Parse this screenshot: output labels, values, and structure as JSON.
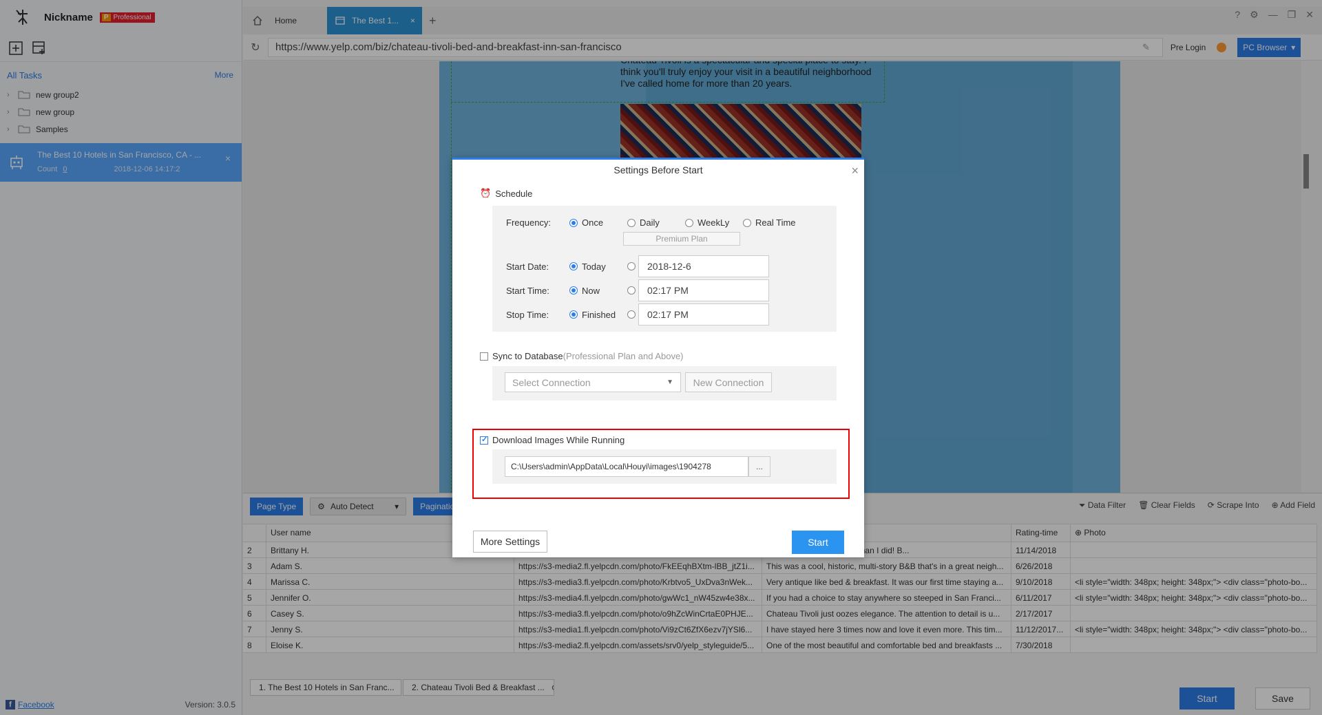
{
  "app": {
    "nickname": "Nickname",
    "plan_badge": "Professional",
    "plan_letter": "P",
    "version": "Version: 3.0.5",
    "facebook": "Facebook"
  },
  "sidebar": {
    "all_tasks": "All Tasks",
    "more": "More",
    "groups": [
      "new group2",
      "new group",
      "Samples"
    ],
    "task": {
      "name": "The Best 10 Hotels in San Francisco, CA - ...",
      "count_label": "Count",
      "count": "0",
      "date": "2018-12-06 14:17:2"
    }
  },
  "tabs": {
    "home": "Home",
    "active": "The Best 1..."
  },
  "address": {
    "url": "https://www.yelp.com/biz/chateau-tivoli-bed-and-breakfast-inn-san-francisco",
    "pre_login": "Pre Login",
    "browser": "PC Browser"
  },
  "webpage": {
    "quote": "Chateau Tivoli is a spectacular and special place to stay. I think you'll truly enjoy your visit in a beautiful neighborhood I've called home for more than 20 years."
  },
  "panel": {
    "page_type": "Page Type",
    "auto_detect": "Auto Detect",
    "pagination": "Paginatio",
    "data_filter": "Data Filter",
    "clear_fields": "Clear Fields",
    "scrape_into": "Scrape Into",
    "add_field": "Add Field",
    "columns": [
      "",
      "User name",
      "",
      "",
      "Rating-time",
      "Photo"
    ],
    "rows": [
      [
        "2",
        "Brittany H.",
        "",
        "oved this place anymore than I did! B...",
        "11/14/2018",
        ""
      ],
      [
        "3",
        "Adam S.",
        "https://s3-media2.fl.yelpcdn.com/photo/FkEEqhBXtm-lBB_jtZ1i...",
        "This was a cool, historic, multi-story B&B that's in a great neigh...",
        "6/26/2018",
        ""
      ],
      [
        "4",
        "Marissa C.",
        "https://s3-media3.fl.yelpcdn.com/photo/Krbtvo5_UxDva3nWek...",
        "Very antique like bed & breakfast. It was our first time staying a...",
        "9/10/2018",
        "<li style=\"width: 348px; height: 348px;\"> <div class=\"photo-bo..."
      ],
      [
        "5",
        "Jennifer O.",
        "https://s3-media4.fl.yelpcdn.com/photo/gwWc1_nW45zw4e38x...",
        "If you had a choice to stay anywhere so steeped in San Franci...",
        "6/11/2017",
        "<li style=\"width: 348px; height: 348px;\"> <div class=\"photo-bo..."
      ],
      [
        "6",
        "Casey S.",
        "https://s3-media3.fl.yelpcdn.com/photo/o9hZcWinCrtaE0PHJE...",
        "Chateau Tivoli just oozes elegance. The attention to detail is u...",
        "2/17/2017",
        ""
      ],
      [
        "7",
        "Jenny S.",
        "https://s3-media1.fl.yelpcdn.com/photo/Vi9zCt6ZfX6ezv7jYSl6...",
        "I have stayed here 3 times now and love it even more. This tim...",
        "11/12/2017...",
        "<li style=\"width: 348px; height: 348px;\"> <div class=\"photo-bo..."
      ],
      [
        "8",
        "Eloise K.",
        "https://s3-media2.fl.yelpcdn.com/assets/srv0/yelp_styleguide/5...",
        "One of the most beautiful and comfortable bed and breakfasts ...",
        "7/30/2018",
        ""
      ]
    ],
    "bottom_tabs": [
      "1. The Best 10 Hotels in San Franc...",
      "2. Chateau Tivoli Bed & Breakfast ..."
    ],
    "start": "Start",
    "save": "Save"
  },
  "modal": {
    "title": "Settings Before Start",
    "schedule": "Schedule",
    "frequency_label": "Frequency:",
    "freq_options": [
      "Once",
      "Daily",
      "WeekLy",
      "Real Time"
    ],
    "premium": "Premium Plan",
    "start_date_label": "Start Date:",
    "today": "Today",
    "start_date_value": "2018-12-6",
    "start_time_label": "Start Time:",
    "now": "Now",
    "start_time_value": "02:17  PM",
    "stop_time_label": "Stop Time:",
    "finished": "Finished",
    "stop_time_value": "02:17  PM",
    "sync_label": "Sync to Database",
    "sync_sub": "(Professional Plan and Above)",
    "select_connection": "Select Connection",
    "new_connection": "New Connection",
    "download_label": "Download Images While Running",
    "download_path": "C:\\Users\\admin\\AppData\\Local\\Houyi\\images\\1904278",
    "browse": "...",
    "more_settings": "More Settings",
    "start": "Start"
  }
}
